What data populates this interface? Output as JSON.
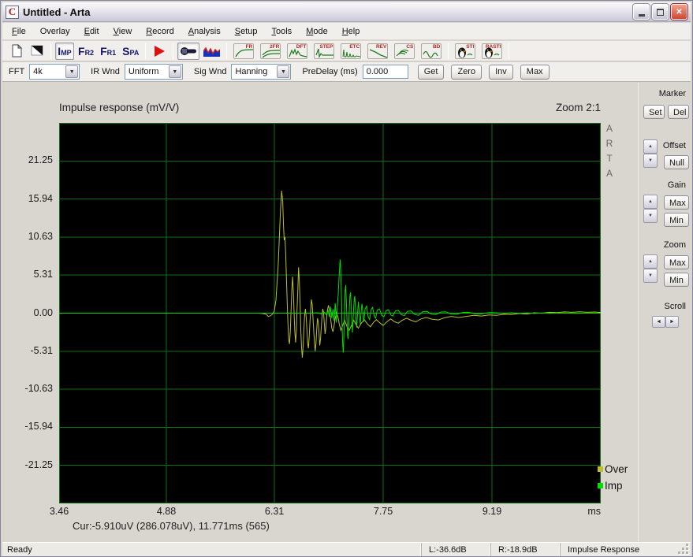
{
  "window": {
    "title": "Untitled - Arta",
    "icon_letter": "C"
  },
  "menu": {
    "items": [
      {
        "pre": "",
        "accel": "F",
        "post": "ile"
      },
      {
        "pre": "Overlay",
        "accel": "",
        "post": ""
      },
      {
        "pre": "",
        "accel": "E",
        "post": "dit"
      },
      {
        "pre": "",
        "accel": "V",
        "post": "iew"
      },
      {
        "pre": "",
        "accel": "R",
        "post": "ecord"
      },
      {
        "pre": "",
        "accel": "A",
        "post": "nalysis"
      },
      {
        "pre": "",
        "accel": "S",
        "post": "etup"
      },
      {
        "pre": "",
        "accel": "T",
        "post": "ools"
      },
      {
        "pre": "",
        "accel": "M",
        "post": "ode"
      },
      {
        "pre": "",
        "accel": "H",
        "post": "elp"
      }
    ]
  },
  "toolbar": {
    "modes": {
      "imp": "IMP",
      "fr2": "FR2",
      "fr1": "FR1",
      "spa": "SPA"
    },
    "tools": {
      "fr": "FR",
      "tfr": "2FR",
      "dft": "DFT",
      "step": "STEP",
      "etc": "ETC",
      "rev": "REV",
      "cs": "CS",
      "bd": "BD",
      "sti": "STI",
      "rasti": "RASTI"
    }
  },
  "controls": {
    "fft_label": "FFT",
    "fft_value": "4k",
    "ir_label": "IR Wnd",
    "ir_value": "Uniform",
    "sig_label": "Sig Wnd",
    "sig_value": "Hanning",
    "predelay_label": "PreDelay (ms)",
    "predelay_value": "0.000",
    "buttons": {
      "get": "Get",
      "zero": "Zero",
      "inv": "Inv",
      "max": "Max"
    }
  },
  "plot": {
    "title": "Impulse response (mV/V)",
    "zoom_label": "Zoom 2:1",
    "watermark": "ARTA",
    "cursor_readout": "Cur:-5.910uV (286.078uV), 11.771ms (565)"
  },
  "side": {
    "marker_label": "Marker",
    "set": "Set",
    "del": "Del",
    "offset_label": "Offset",
    "null": "Null",
    "gain_label": "Gain",
    "gain_max": "Max",
    "gain_min": "Min",
    "zoom_label": "Zoom",
    "zoom_max": "Max",
    "zoom_min": "Min",
    "scroll_label": "Scroll"
  },
  "status": {
    "ready": "Ready",
    "left": "L:-36.6dB",
    "right": "R:-18.9dB",
    "mode": "Impulse Response"
  },
  "chart_data": {
    "type": "line",
    "title": "Impulse response (mV/V)",
    "xlabel": "ms",
    "ylabel": "mV/V",
    "xlim": [
      3.46,
      10.63
    ],
    "ylim": [
      -26.56,
      26.56
    ],
    "x_unit_label": "ms",
    "grid": true,
    "legend_position": "bottom-right",
    "background": "#000000",
    "grid_color": "#0d720d",
    "zero_line_color": "#00b400",
    "x_ticks": [
      {
        "v": 3.46,
        "label": "3.46"
      },
      {
        "v": 4.88,
        "label": "4.88"
      },
      {
        "v": 6.31,
        "label": "6.31"
      },
      {
        "v": 7.75,
        "label": "7.75"
      },
      {
        "v": 9.19,
        "label": "9.19"
      }
    ],
    "y_ticks": [
      {
        "v": 21.25,
        "label": "21.25"
      },
      {
        "v": 15.94,
        "label": "15.94"
      },
      {
        "v": 10.63,
        "label": "10.63"
      },
      {
        "v": 5.31,
        "label": "5.31"
      },
      {
        "v": 0,
        "label": "0.00"
      },
      {
        "v": -5.31,
        "label": "-5.31"
      },
      {
        "v": -10.63,
        "label": "-10.63"
      },
      {
        "v": -15.94,
        "label": "-15.94"
      },
      {
        "v": -21.25,
        "label": "-21.25"
      }
    ],
    "series": [
      {
        "name": "Over",
        "color": "#bdbd2e",
        "points": [
          [
            3.46,
            0
          ],
          [
            4.2,
            0
          ],
          [
            5.0,
            0
          ],
          [
            5.6,
            0
          ],
          [
            6.0,
            0
          ],
          [
            6.1,
            0
          ],
          [
            6.16,
            -0.05
          ],
          [
            6.2,
            -0.15
          ],
          [
            6.23,
            -0.45
          ],
          [
            6.26,
            -0.35
          ],
          [
            6.29,
            -0.08
          ],
          [
            6.31,
            0.4
          ],
          [
            6.33,
            1.8
          ],
          [
            6.345,
            4.2
          ],
          [
            6.36,
            6.8
          ],
          [
            6.375,
            10.5
          ],
          [
            6.39,
            14.2
          ],
          [
            6.405,
            17.1
          ],
          [
            6.42,
            15.6
          ],
          [
            6.43,
            12.2
          ],
          [
            6.44,
            10.2
          ],
          [
            6.45,
            10.6
          ],
          [
            6.46,
            8.2
          ],
          [
            6.47,
            4.6
          ],
          [
            6.48,
            1.2
          ],
          [
            6.49,
            -1.6
          ],
          [
            6.5,
            -3.8
          ],
          [
            6.51,
            -4.3
          ],
          [
            6.52,
            -2.6
          ],
          [
            6.53,
            0.4
          ],
          [
            6.54,
            3.1
          ],
          [
            6.55,
            5.1
          ],
          [
            6.56,
            3.2
          ],
          [
            6.57,
            0.2
          ],
          [
            6.58,
            -2.5
          ],
          [
            6.59,
            -4.1
          ],
          [
            6.6,
            -2.4
          ],
          [
            6.61,
            0.6
          ],
          [
            6.62,
            3.4
          ],
          [
            6.63,
            6.4
          ],
          [
            6.64,
            4.4
          ],
          [
            6.65,
            1.0
          ],
          [
            6.66,
            -2.6
          ],
          [
            6.67,
            -5.0
          ],
          [
            6.68,
            -6.2
          ],
          [
            6.69,
            -4.6
          ],
          [
            6.7,
            -2.4
          ],
          [
            6.71,
            -0.3
          ],
          [
            6.72,
            0.6
          ],
          [
            6.73,
            -0.5
          ],
          [
            6.74,
            -2.3
          ],
          [
            6.75,
            -4.2
          ],
          [
            6.76,
            -4.9
          ],
          [
            6.77,
            -3.3
          ],
          [
            6.78,
            -1.3
          ],
          [
            6.79,
            0.5
          ],
          [
            6.8,
            1.9
          ],
          [
            6.81,
            1.2
          ],
          [
            6.82,
            -0.5
          ],
          [
            6.83,
            -2.4
          ],
          [
            6.84,
            -4.1
          ],
          [
            6.85,
            -5.3
          ],
          [
            6.86,
            -4.2
          ],
          [
            6.87,
            -2.3
          ],
          [
            6.88,
            -0.7
          ],
          [
            6.89,
            -1.2
          ],
          [
            6.9,
            -2.7
          ],
          [
            6.91,
            -4.5
          ],
          [
            6.92,
            -3.7
          ],
          [
            6.93,
            -2.0
          ],
          [
            6.94,
            -0.5
          ],
          [
            6.95,
            0.6
          ],
          [
            6.96,
            0.1
          ],
          [
            6.97,
            -1.3
          ],
          [
            6.98,
            -2.9
          ],
          [
            6.99,
            -2.2
          ],
          [
            7.0,
            -0.8
          ],
          [
            7.01,
            0.3
          ],
          [
            7.025,
            1.1
          ],
          [
            7.04,
            0.4
          ],
          [
            7.055,
            -0.9
          ],
          [
            7.07,
            -2.1
          ],
          [
            7.085,
            -2.6
          ],
          [
            7.1,
            -1.7
          ],
          [
            7.115,
            -0.7
          ],
          [
            7.13,
            0.1
          ],
          [
            7.15,
            -0.5
          ],
          [
            7.17,
            -1.6
          ],
          [
            7.19,
            -2.4
          ],
          [
            7.21,
            -1.8
          ],
          [
            7.24,
            -1.0
          ],
          [
            7.27,
            -1.9
          ],
          [
            7.3,
            -2.4
          ],
          [
            7.33,
            -1.7
          ],
          [
            7.36,
            -1.0
          ],
          [
            7.39,
            -1.6
          ],
          [
            7.42,
            -2.1
          ],
          [
            7.46,
            -1.4
          ],
          [
            7.5,
            -0.9
          ],
          [
            7.54,
            -1.5
          ],
          [
            7.58,
            -1.9
          ],
          [
            7.62,
            -1.3
          ],
          [
            7.66,
            -0.9
          ],
          [
            7.71,
            -1.4
          ],
          [
            7.75,
            -1.7
          ],
          [
            7.8,
            -1.2
          ],
          [
            7.85,
            -0.8
          ],
          [
            7.9,
            -1.2
          ],
          [
            7.95,
            -1.4
          ],
          [
            8.0,
            -1.0
          ],
          [
            8.06,
            -0.7
          ],
          [
            8.12,
            -1.0
          ],
          [
            8.18,
            -1.2
          ],
          [
            8.25,
            -0.8
          ],
          [
            8.32,
            -0.6
          ],
          [
            8.4,
            -0.85
          ],
          [
            8.48,
            -0.95
          ],
          [
            8.56,
            -0.65
          ],
          [
            8.65,
            -0.45
          ],
          [
            8.75,
            -0.6
          ],
          [
            8.85,
            -0.45
          ],
          [
            8.95,
            -0.3
          ],
          [
            9.05,
            -0.4
          ],
          [
            9.15,
            -0.25
          ],
          [
            9.25,
            -0.3
          ],
          [
            9.35,
            -0.15
          ],
          [
            9.45,
            -0.2
          ],
          [
            9.55,
            -0.05
          ],
          [
            9.65,
            -0.12
          ],
          [
            9.75,
            0.05
          ],
          [
            9.85,
            0.0
          ],
          [
            9.95,
            0.12
          ],
          [
            10.05,
            0.08
          ],
          [
            10.15,
            0.18
          ],
          [
            10.25,
            0.12
          ],
          [
            10.35,
            0.2
          ],
          [
            10.45,
            0.12
          ],
          [
            10.55,
            0.16
          ],
          [
            10.63,
            0.1
          ]
        ]
      },
      {
        "name": "Imp",
        "color": "#00dd00",
        "points": [
          [
            3.46,
            0
          ],
          [
            4.5,
            0
          ],
          [
            5.5,
            0
          ],
          [
            6.2,
            0
          ],
          [
            6.6,
            0
          ],
          [
            6.8,
            0
          ],
          [
            6.88,
            0.06
          ],
          [
            6.93,
            -0.1
          ],
          [
            6.97,
            0.15
          ],
          [
            7.0,
            -0.25
          ],
          [
            7.02,
            0.35
          ],
          [
            7.04,
            -0.5
          ],
          [
            7.055,
            0.9
          ],
          [
            7.07,
            -0.7
          ],
          [
            7.085,
            0.55
          ],
          [
            7.1,
            -1.1
          ],
          [
            7.115,
            1.4
          ],
          [
            7.13,
            -1.3
          ],
          [
            7.145,
            1.3
          ],
          [
            7.155,
            2.6
          ],
          [
            7.165,
            4.8
          ],
          [
            7.175,
            6.8
          ],
          [
            7.183,
            7.5
          ],
          [
            7.19,
            5.0
          ],
          [
            7.198,
            1.8
          ],
          [
            7.206,
            -1.8
          ],
          [
            7.214,
            -4.4
          ],
          [
            7.222,
            -5.5
          ],
          [
            7.23,
            -3.0
          ],
          [
            7.238,
            0.3
          ],
          [
            7.246,
            3.2
          ],
          [
            7.254,
            3.9
          ],
          [
            7.262,
            1.7
          ],
          [
            7.27,
            -0.9
          ],
          [
            7.278,
            -3.0
          ],
          [
            7.286,
            -3.6
          ],
          [
            7.294,
            -1.7
          ],
          [
            7.302,
            0.7
          ],
          [
            7.31,
            2.5
          ],
          [
            7.318,
            2.9
          ],
          [
            7.326,
            1.1
          ],
          [
            7.334,
            -1.1
          ],
          [
            7.342,
            -2.7
          ],
          [
            7.35,
            -1.3
          ],
          [
            7.358,
            0.5
          ],
          [
            7.366,
            2.0
          ],
          [
            7.374,
            2.4
          ],
          [
            7.382,
            0.8
          ],
          [
            7.39,
            -0.9
          ],
          [
            7.398,
            -2.0
          ],
          [
            7.406,
            -0.8
          ],
          [
            7.414,
            0.6
          ],
          [
            7.422,
            1.6
          ],
          [
            7.43,
            0.5
          ],
          [
            7.438,
            -0.7
          ],
          [
            7.446,
            -1.5
          ],
          [
            7.454,
            -0.4
          ],
          [
            7.462,
            0.8
          ],
          [
            7.47,
            1.3
          ],
          [
            7.478,
            0.3
          ],
          [
            7.486,
            -0.8
          ],
          [
            7.494,
            -1.2
          ],
          [
            7.51,
            0.6
          ],
          [
            7.53,
            1.0
          ],
          [
            7.55,
            -0.5
          ],
          [
            7.57,
            -0.9
          ],
          [
            7.59,
            0.5
          ],
          [
            7.61,
            0.8
          ],
          [
            7.63,
            -0.4
          ],
          [
            7.65,
            -0.7
          ],
          [
            7.67,
            0.4
          ],
          [
            7.7,
            0.6
          ],
          [
            7.73,
            -0.3
          ],
          [
            7.76,
            -0.5
          ],
          [
            7.79,
            0.35
          ],
          [
            7.82,
            0.5
          ],
          [
            7.85,
            -0.25
          ],
          [
            7.88,
            -0.4
          ],
          [
            7.91,
            0.3
          ],
          [
            7.95,
            0.4
          ],
          [
            7.99,
            -0.2
          ],
          [
            8.03,
            -0.35
          ],
          [
            8.07,
            0.25
          ],
          [
            8.12,
            0.3
          ],
          [
            8.17,
            -0.2
          ],
          [
            8.22,
            -0.3
          ],
          [
            8.27,
            0.2
          ],
          [
            8.33,
            0.25
          ],
          [
            8.39,
            -0.15
          ],
          [
            8.45,
            -0.2
          ],
          [
            8.51,
            0.15
          ],
          [
            8.58,
            0.2
          ],
          [
            8.65,
            -0.12
          ],
          [
            8.72,
            -0.15
          ],
          [
            8.8,
            0.1
          ],
          [
            8.88,
            0.12
          ],
          [
            8.96,
            -0.08
          ],
          [
            9.05,
            -0.1
          ],
          [
            9.15,
            0.08
          ],
          [
            9.25,
            0.06
          ],
          [
            9.35,
            -0.06
          ],
          [
            9.45,
            0.05
          ],
          [
            9.55,
            -0.05
          ],
          [
            9.65,
            0.04
          ],
          [
            9.75,
            -0.04
          ],
          [
            9.85,
            0.03
          ],
          [
            9.95,
            -0.03
          ],
          [
            10.1,
            0.02
          ],
          [
            10.3,
            -0.02
          ],
          [
            10.5,
            0.01
          ],
          [
            10.63,
            0
          ]
        ]
      }
    ]
  }
}
